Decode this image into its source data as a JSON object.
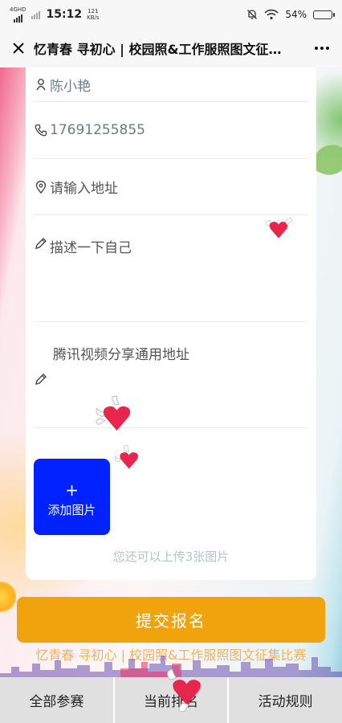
{
  "status_bar": {
    "network_label": "4GHD",
    "time": "15:12",
    "speed_value": "121",
    "speed_unit": "KB/s",
    "battery_percent": "54%",
    "battery_level": 0.54
  },
  "title_bar": {
    "title": "忆青春 寻初心 | 校园照&工作服照图文征…"
  },
  "form": {
    "name_value": "陈小艳",
    "phone_value": "17691255855",
    "address_placeholder": "请输入地址",
    "describe_placeholder": "描述一下自己",
    "video_placeholder": "腾讯视频分享通用地址",
    "upload_plus": "+",
    "upload_label": "添加图片",
    "remaining_text": "您还可以上传3张图片"
  },
  "submit_label": "提交报名",
  "banner_text": "忆青春 寻初心 | 校园照&工作服照图文征集比赛",
  "bottom_nav": {
    "items": [
      {
        "label": "全部参赛"
      },
      {
        "label": "当前排名"
      },
      {
        "label": "活动规则"
      }
    ]
  },
  "colors": {
    "submit": "#f0a30d",
    "upload": "#0022ff",
    "heart": "#e8254d"
  }
}
